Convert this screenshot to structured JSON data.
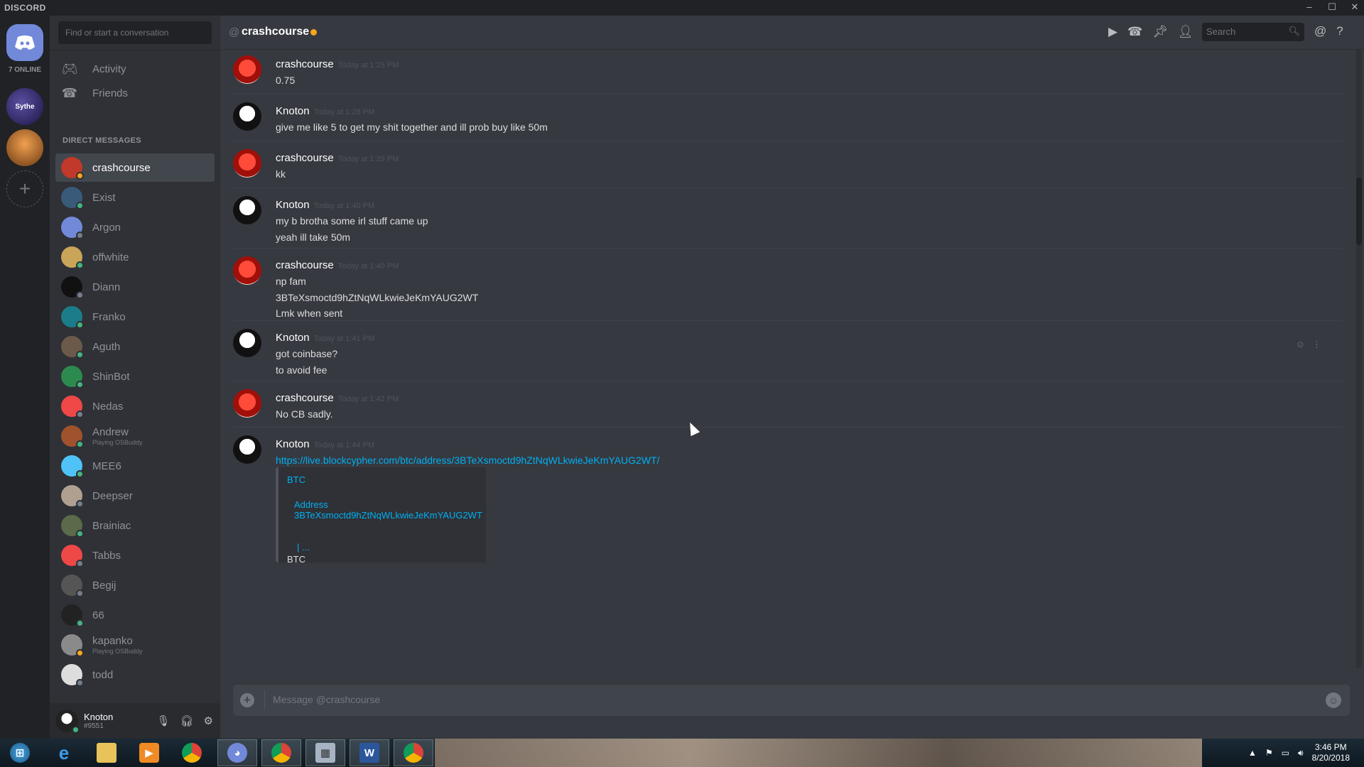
{
  "window": {
    "brand": "DISCORD",
    "controls": [
      "–",
      "☐",
      "✕"
    ]
  },
  "guilds": {
    "online_label": "7 ONLINE",
    "servers": [
      {
        "name": "Sythe",
        "label": "Sythe"
      },
      {
        "name": "Village",
        "label": ""
      }
    ],
    "add_label": "+"
  },
  "sidebar": {
    "search_placeholder": "Find or start a conversation",
    "nav": [
      {
        "label": "Activity",
        "icon": "gamepad-icon"
      },
      {
        "label": "Friends",
        "icon": "friends-icon"
      }
    ],
    "dm_header": "DIRECT MESSAGES",
    "dms": [
      {
        "name": "crashcourse",
        "sub": "",
        "status": "idle",
        "color": "#c0392b",
        "selected": true
      },
      {
        "name": "Exist",
        "sub": "",
        "status": "online",
        "color": "#3a5a7a"
      },
      {
        "name": "Argon",
        "sub": "",
        "status": "off",
        "color": "#7289da"
      },
      {
        "name": "offwhite",
        "sub": "",
        "status": "online",
        "color": "#c9a55a"
      },
      {
        "name": "Diann",
        "sub": "",
        "status": "off",
        "color": "#111111"
      },
      {
        "name": "Franko",
        "sub": "",
        "status": "online",
        "color": "#1c7d8a"
      },
      {
        "name": "Aguth",
        "sub": "",
        "status": "online",
        "color": "#6b5a4a"
      },
      {
        "name": "ShinBot",
        "sub": "",
        "status": "online",
        "color": "#2d8a4e"
      },
      {
        "name": "Nedas",
        "sub": "",
        "status": "off",
        "color": "#f04747"
      },
      {
        "name": "Andrew",
        "sub": "Playing OSBuddy",
        "status": "online",
        "color": "#a0522d"
      },
      {
        "name": "MEE6",
        "sub": "",
        "status": "online",
        "color": "#4fc3f7"
      },
      {
        "name": "Deepser",
        "sub": "",
        "status": "off",
        "color": "#b0a090"
      },
      {
        "name": "Brainiac",
        "sub": "",
        "status": "online",
        "color": "#5a6a4a"
      },
      {
        "name": "Tabbs",
        "sub": "",
        "status": "off",
        "color": "#f04747"
      },
      {
        "name": "Begij",
        "sub": "",
        "status": "off",
        "color": "#555555"
      },
      {
        "name": "66",
        "sub": "",
        "status": "online",
        "color": "#222222"
      },
      {
        "name": "kapanko",
        "sub": "Playing OSBuddy",
        "status": "idle",
        "color": "#8a8a8a"
      },
      {
        "name": "todd",
        "sub": "",
        "status": "off",
        "color": "#dddddd"
      }
    ]
  },
  "user": {
    "name": "Knoton",
    "tag": "#9551"
  },
  "header": {
    "at": "@",
    "title": "crashcourse",
    "search_placeholder": "Search"
  },
  "messages": [
    {
      "author": "crashcourse",
      "time": "Today at 1:25 PM",
      "lines": [
        "0.75"
      ],
      "avatar": "cc"
    },
    {
      "author": "Knoton",
      "time": "Today at 1:28 PM",
      "lines": [
        "give me like 5 to get my shit together and ill prob buy like 50m"
      ],
      "avatar": "kn"
    },
    {
      "author": "crashcourse",
      "time": "Today at 1:29 PM",
      "lines": [
        "kk"
      ],
      "avatar": "cc"
    },
    {
      "author": "Knoton",
      "time": "Today at 1:40 PM",
      "lines": [
        "my b brotha some irl stuff came up",
        "yeah ill take 50m"
      ],
      "avatar": "kn"
    },
    {
      "author": "crashcourse",
      "time": "Today at 1:40 PM",
      "lines": [
        "np fam",
        "3BTeXsmoctd9hZtNqWLkwieJeKmYAUG2WT",
        "Lmk when sent"
      ],
      "avatar": "cc"
    },
    {
      "author": "Knoton",
      "time": "Today at 1:41 PM",
      "lines": [
        "got coinbase?",
        "to avoid fee"
      ],
      "avatar": "kn"
    },
    {
      "author": "crashcourse",
      "time": "Today at 1:42 PM",
      "lines": [
        "No CB sadly."
      ],
      "avatar": "cc"
    },
    {
      "author": "Knoton",
      "time": "Today at 1:44 PM",
      "link": "https://live.blockcypher.com/btc/address/3BTeXsmoctd9hZtNqWLkwieJeKmYAUG2WT/",
      "avatar": "kn",
      "embed": {
        "provider": "BTC",
        "title": "Address 3BTeXsmoctd9hZtNqWLkwieJeKmYAUG2WT",
        "ellipsis": "| ...",
        "footer": "BTC"
      }
    }
  ],
  "composer": {
    "placeholder": "Message @crashcourse"
  },
  "taskbar": {
    "time": "3:46 PM",
    "date": "8/20/2018"
  }
}
